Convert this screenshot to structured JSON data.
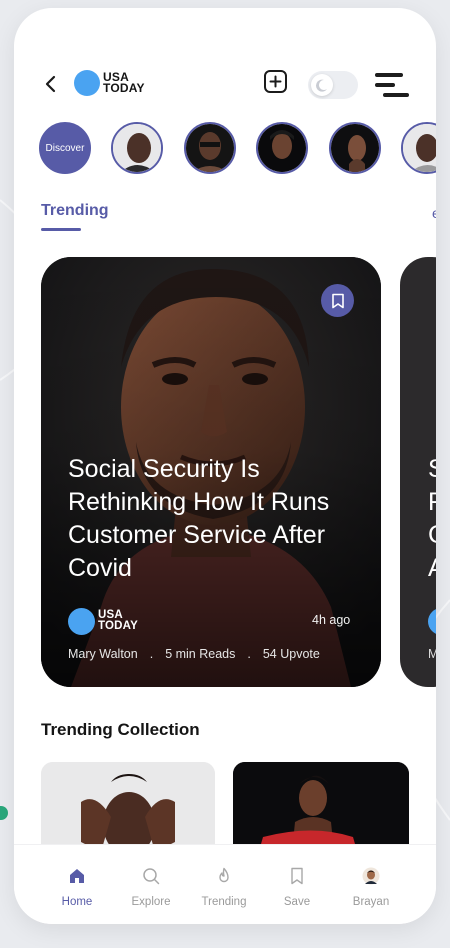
{
  "header": {
    "logo_line1": "USA",
    "logo_line2": "TODAY"
  },
  "stories": {
    "discover_label": "Discover"
  },
  "tabs": {
    "active": "Trending",
    "next_partial": "e"
  },
  "featured": {
    "headline": "Social Security Is Rethinking How It Runs Customer Service After Covid",
    "publisher_line1": "USA",
    "publisher_line2": "TODAY",
    "time": "4h ago",
    "author": "Mary Walton",
    "sep1": ".",
    "reads": "5 min Reads",
    "sep2": ".",
    "upvotes": "54 Upvote"
  },
  "next_card": {
    "letters": "S\nF\nC\nA",
    "meta_partial": "M"
  },
  "collection": {
    "title": "Trending Collection"
  },
  "bottom_nav": [
    {
      "label": "Home",
      "icon": "home-icon",
      "active": true
    },
    {
      "label": "Explore",
      "icon": "search-icon",
      "active": false
    },
    {
      "label": "Trending",
      "icon": "flame-icon",
      "active": false
    },
    {
      "label": "Save",
      "icon": "bookmark-icon",
      "active": false
    },
    {
      "label": "Brayan",
      "icon": "avatar",
      "active": false
    }
  ],
  "colors": {
    "accent": "#575ba7",
    "logo_blue": "#4aa3f1",
    "background": "#e9ebef"
  }
}
